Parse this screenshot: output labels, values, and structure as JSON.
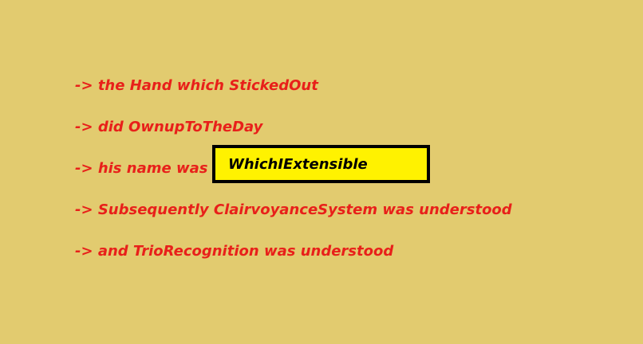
{
  "lines": {
    "line1": "-> the Hand which StickedOut",
    "line2": "-> did OwnupToTheDay",
    "line3_prefix": "-> his name was",
    "line4": "-> Subsequently ClairvoyanceSystem was understood",
    "line5": "-> and TrioRecognition was understood"
  },
  "name_input": {
    "value": "WhichIExtensible"
  },
  "colors": {
    "background": "#e2cb6f",
    "text": "#e8201a",
    "input_background": "#fff200",
    "input_border": "#000000"
  }
}
